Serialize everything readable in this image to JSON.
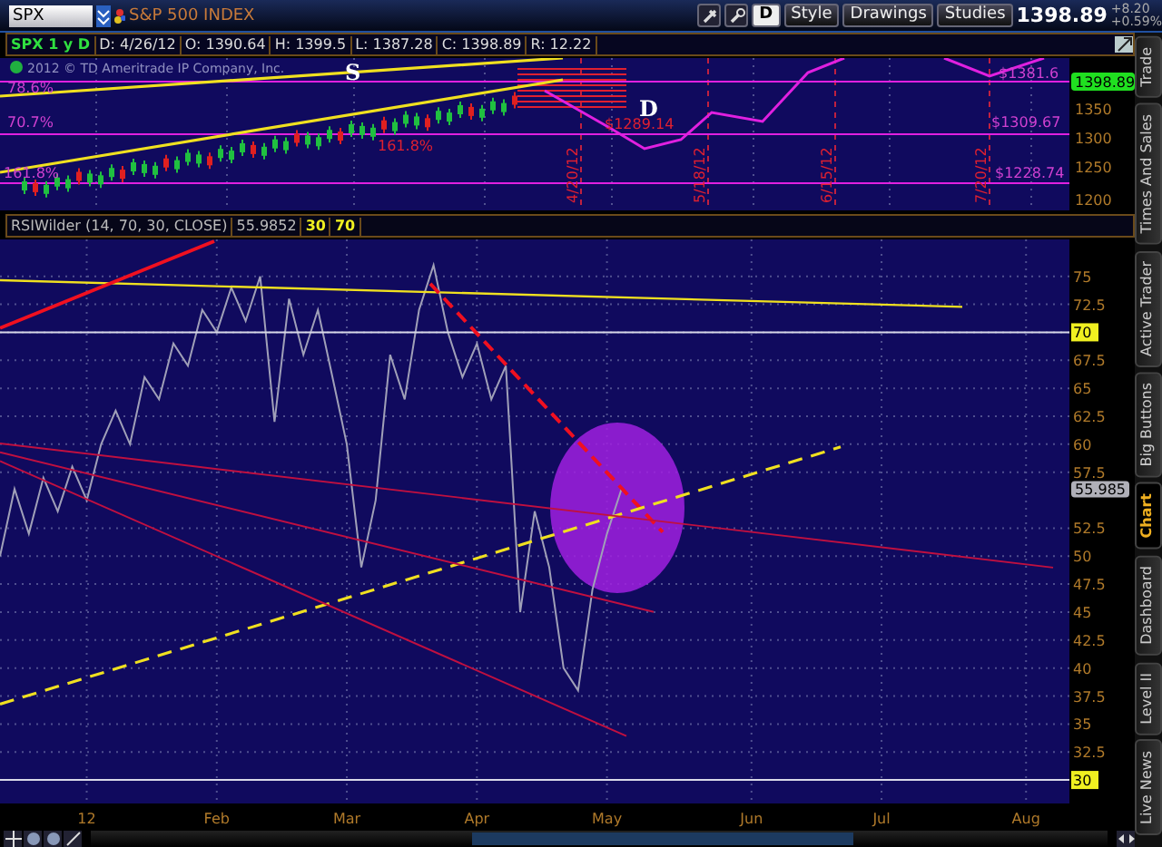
{
  "header": {
    "symbol": "SPX",
    "title": "S&P 500 INDEX",
    "buttons": [
      "D",
      "Style",
      "Drawings",
      "Studies"
    ],
    "last_price": "1398.89",
    "change": "+8.20",
    "change_pct": "+0.59%"
  },
  "info_bar": {
    "symbol_period": "SPX 1 y D",
    "fields": [
      "D: 4/26/12",
      "O: 1390.64",
      "H: 1399.5",
      "L: 1387.28",
      "C: 1398.89",
      "R: 12.22"
    ]
  },
  "price_panel": {
    "copyright": "2012 © TD Ameritrade IP Company, Inc.",
    "annotations": [
      {
        "text": "78.6%",
        "color": "#d040d0"
      },
      {
        "text": "70.7%",
        "color": "#d040d0"
      },
      {
        "text": "161.8%",
        "color": "#d040d0"
      },
      {
        "text": "S",
        "color": "#ffffff"
      },
      {
        "text": "161.8%",
        "color": "#e02030"
      },
      {
        "text": "$1289.14",
        "color": "#e02030"
      },
      {
        "text": "D",
        "color": "#ffffff"
      },
      {
        "text": "$1381.6",
        "color": "#d040d0"
      },
      {
        "text": "$1309.67",
        "color": "#d040d0"
      },
      {
        "text": "$1228.74",
        "color": "#d040d0"
      }
    ],
    "date_labels": [
      "4/20/12",
      "5/18/12",
      "6/15/12",
      "7/20/12"
    ],
    "axis_labels": [
      "1350",
      "1300",
      "1250",
      "1200"
    ],
    "price_tag": "1398.89"
  },
  "study": {
    "params": "(14, 70, 30, CLOSE)",
    "value": "55.9852",
    "levels": [
      "30",
      "70"
    ],
    "value_tag": "55.985",
    "chart_data": {
      "type": "line",
      "ylim": [
        27.9,
        78.3
      ],
      "grid": true,
      "yticks": [
        30,
        32.5,
        35,
        37.5,
        40,
        42.5,
        45,
        47.5,
        50,
        52.5,
        57.5,
        60,
        62.5,
        65,
        67.5,
        70,
        72.5,
        75
      ],
      "categories": [
        null,
        null,
        null,
        null,
        null,
        null,
        "12",
        null,
        null,
        null,
        null,
        null,
        null,
        null,
        null,
        "Feb",
        null,
        null,
        null,
        null,
        null,
        null,
        null,
        null,
        "Mar",
        null,
        null,
        null,
        null,
        null,
        null,
        null,
        null,
        "Apr",
        null,
        null,
        null,
        null,
        null,
        null,
        null,
        null,
        "May",
        null,
        null,
        null,
        null,
        null,
        null,
        null,
        null,
        null,
        "Jun",
        null,
        null,
        null,
        null,
        null,
        null,
        null,
        null,
        "Jul",
        null,
        null,
        null,
        null,
        null,
        null,
        null,
        null,
        null,
        "Aug",
        null,
        null,
        null
      ],
      "series": [
        {
          "name": "RSIWilder",
          "color": "#a0a0b8",
          "values": [
            50,
            56,
            52,
            57,
            54,
            58,
            55,
            60,
            63,
            60,
            66,
            64,
            69,
            67,
            72,
            70,
            74,
            71,
            75,
            62,
            73,
            68,
            72,
            66,
            60,
            49,
            55,
            68,
            64,
            72,
            76,
            70,
            66,
            69,
            64,
            67,
            45,
            54,
            49,
            40,
            38,
            47,
            52,
            56,
            null,
            null,
            null,
            null,
            null,
            null,
            null,
            null,
            null,
            null,
            null,
            null,
            null,
            null,
            null,
            null,
            null,
            null,
            null,
            null,
            null,
            null,
            null,
            null,
            null,
            null,
            null,
            null,
            null,
            null,
            null
          ]
        }
      ]
    }
  },
  "side_tabs": [
    {
      "label": "Trade",
      "selected": false
    },
    {
      "label": "Times And Sales",
      "selected": false
    },
    {
      "label": "Active Trader",
      "selected": false
    },
    {
      "label": "Big Buttons",
      "selected": false
    },
    {
      "label": "Chart",
      "selected": true
    },
    {
      "label": "Dashboard",
      "selected": false
    },
    {
      "label": "Level II",
      "selected": false
    },
    {
      "label": "Live News",
      "selected": false
    }
  ]
}
